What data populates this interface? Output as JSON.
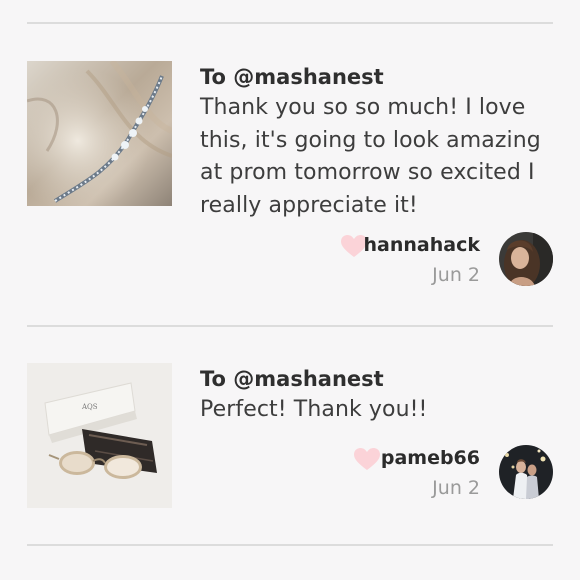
{
  "reviews": [
    {
      "to": "To @mashanest",
      "message": "Thank you so so much! I love this, it's going to look amazing at prom tomorrow so excited I really appreciate it!",
      "username": "hannahack",
      "date": "Jun 2",
      "item_icon": "rhinestone-headband-photo",
      "avatar_icon": "user-avatar-photo",
      "liked": true
    },
    {
      "to": "To @mashanest",
      "message": "Perfect! Thank you!!",
      "username": "pameb66",
      "date": "Jun 2",
      "item_icon": "sunglasses-with-case-photo",
      "avatar_icon": "user-avatar-photo",
      "case_label": "AQS",
      "liked": true
    }
  ],
  "colors": {
    "heart": "#fbd3d8",
    "divider": "#dcdcdc",
    "background": "#f7f6f7",
    "date": "#9a9a9a"
  }
}
